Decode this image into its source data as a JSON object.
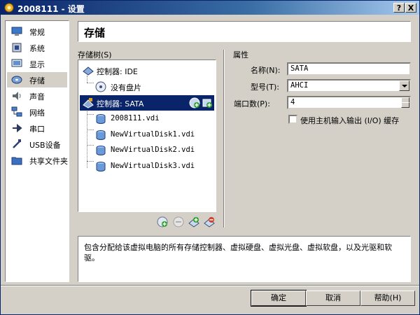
{
  "window": {
    "title": "2008111 - 设置",
    "help_btn": "?",
    "close_btn": "X"
  },
  "nav": {
    "items": [
      {
        "label": "常规"
      },
      {
        "label": "系统"
      },
      {
        "label": "显示"
      },
      {
        "label": "存储"
      },
      {
        "label": "声音"
      },
      {
        "label": "网络"
      },
      {
        "label": "串口"
      },
      {
        "label": "USB设备"
      },
      {
        "label": "共享文件夹"
      }
    ],
    "selected": "存储"
  },
  "section_title": "存储",
  "storage_tree": {
    "label": "存储树(S)",
    "items": [
      {
        "label": "控制器: IDE"
      },
      {
        "label": "没有盘片"
      },
      {
        "label": "控制器: SATA"
      },
      {
        "label": "2008111.vdi"
      },
      {
        "label": "NewVirtualDisk1.vdi"
      },
      {
        "label": "NewVirtualDisk2.vdi"
      },
      {
        "label": "NewVirtualDisk3.vdi"
      }
    ],
    "selected": "控制器: SATA"
  },
  "attributes": {
    "label": "属性",
    "name_label": "名称(N):",
    "name_value": "SATA",
    "type_label": "型号(T):",
    "type_value": "AHCI",
    "ports_label": "端口数(P):",
    "ports_value": "4",
    "host_io_label": "使用主机输入输出 (I/O) 缓存",
    "host_io_checked": false
  },
  "info_text": "包含分配给该虚拟电脑的所有存储控制器、虚拟硬盘、虚拟光盘、虚拟软盘，以及光驱和软驱。",
  "buttons": {
    "ok": "确定",
    "cancel": "取消",
    "help": "帮助(H)"
  },
  "colors": {
    "title_bar": "#0a246a",
    "selection": "#0a246a",
    "window_bg": "#d4d0c8"
  }
}
